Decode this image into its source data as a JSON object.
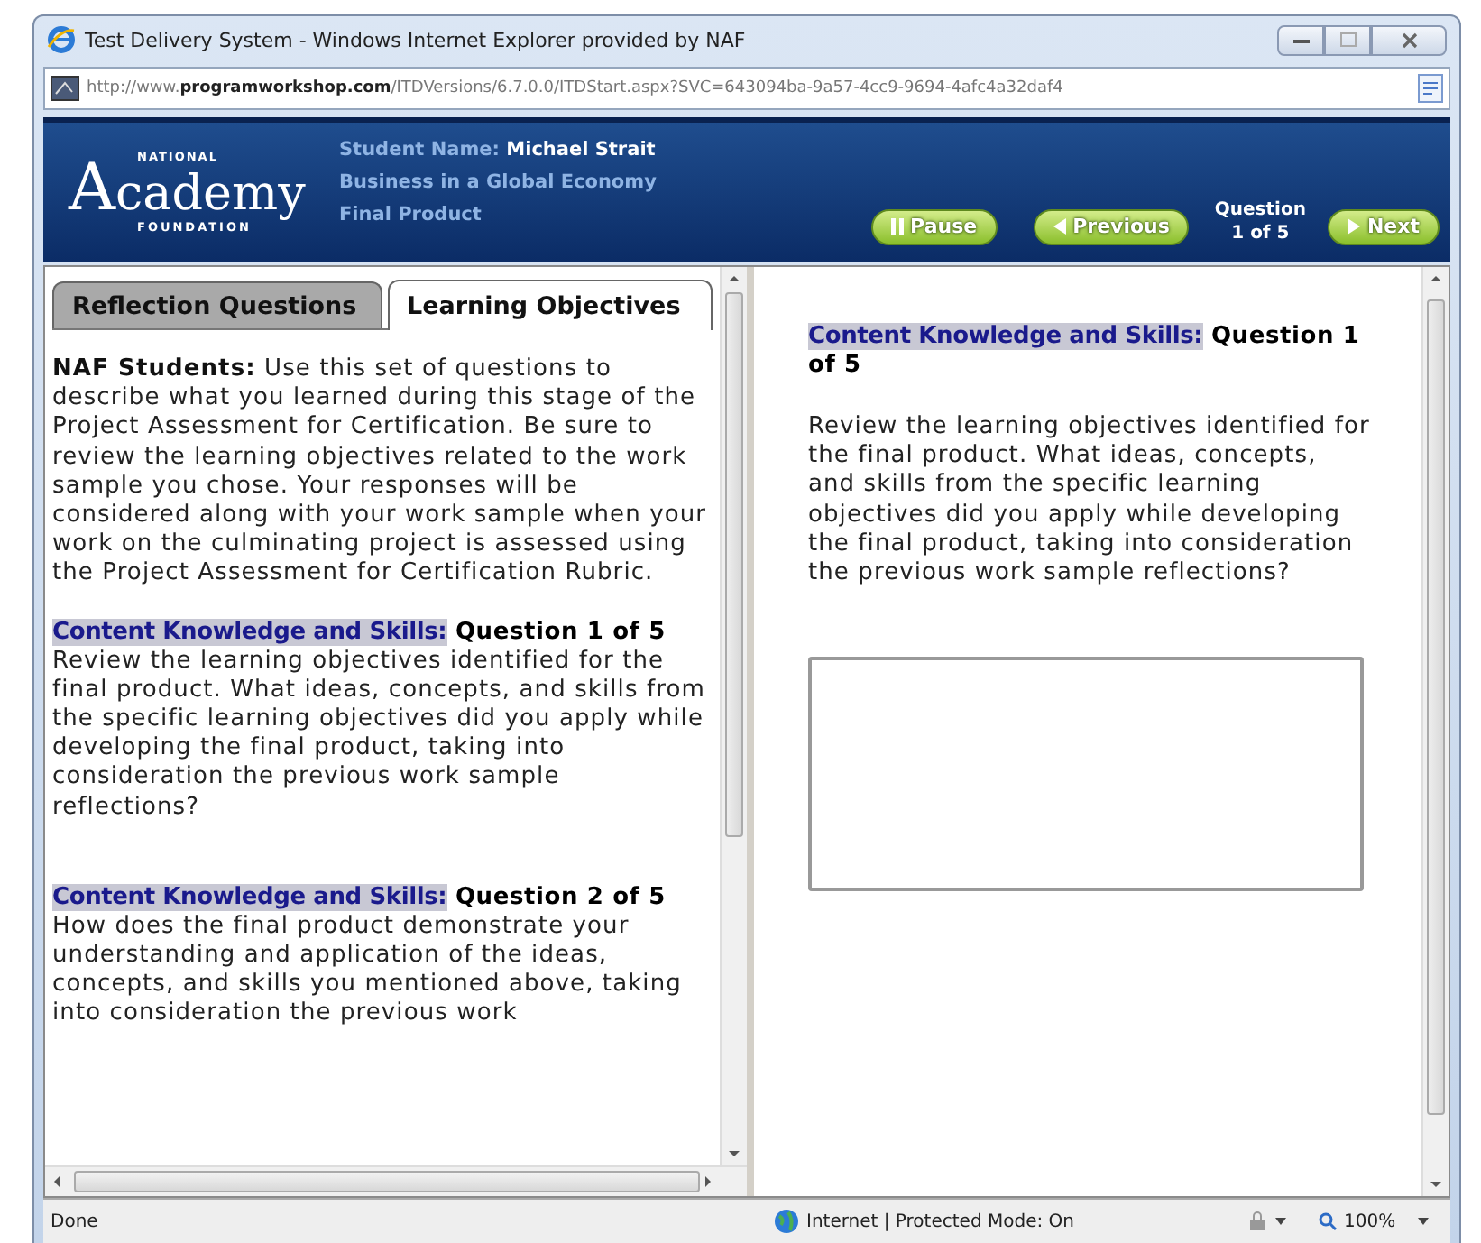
{
  "window": {
    "title": "Test Delivery System - Windows Internet Explorer provided by NAF"
  },
  "address_bar": {
    "url": "http://www.**programworkshop.com**/ITDVersions/6.7.0.0/ITDStart.aspx?SVC=643094ba-9a57-4cc9-9694-4afc4a32daf4"
  },
  "header": {
    "logo": {
      "top": "NATIONAL",
      "main": "Academy",
      "bottom": "FOUNDATION"
    },
    "student_label": "Student Name:",
    "student_name": "Michael Strait",
    "course": "Business in a Global Economy",
    "product": "Final Product",
    "buttons": [
      {
        "kind": "pause",
        "label": "Pause"
      },
      {
        "kind": "previous",
        "label": "Previous"
      },
      {
        "kind": "counter",
        "label": "Question",
        "value": "1 of 5"
      },
      {
        "kind": "next",
        "label": "Next"
      }
    ]
  },
  "left_pane": {
    "tabs": [
      {
        "label": "Reflection Questions",
        "selected": false
      },
      {
        "label": "Learning Objectives",
        "selected": true
      }
    ],
    "intro": "**NAF Students:** Use this set of questions to describe what you learned during this stage of the Project Assessment for Certification. Be sure to review the learning objectives related to the work sample you chose. Your responses will be considered along with your work sample when your work on the culminating project is assessed using the Project Assessment for Certification Rubric.",
    "questions": [
      {
        "category": "Content Knowledge and Skills:",
        "title": "Question 1 of 5",
        "text": "Review the learning objectives identified for the final product. What ideas, concepts, and skills from the specific learning objectives did you apply while developing the final product, taking into consideration the previous work sample reflections?"
      },
      {
        "category": "Content Knowledge and Skills:",
        "title": "Question 2 of 5",
        "text": "How does the final product demonstrate your understanding and application of the ideas, concepts, and skills you mentioned above, taking into consideration the previous work"
      }
    ]
  },
  "right_pane": {
    "category": "Content Knowledge and Skills:",
    "title": "Question 1 of 5",
    "text": "Review the learning objectives identified for the final product. What ideas, concepts, and skills from the specific learning objectives did you apply while developing the final product, taking into consideration the previous work sample reflections?"
  },
  "status_bar": {
    "status": "Done",
    "zone": "Internet | Protected Mode: On",
    "zoom": "100%"
  }
}
